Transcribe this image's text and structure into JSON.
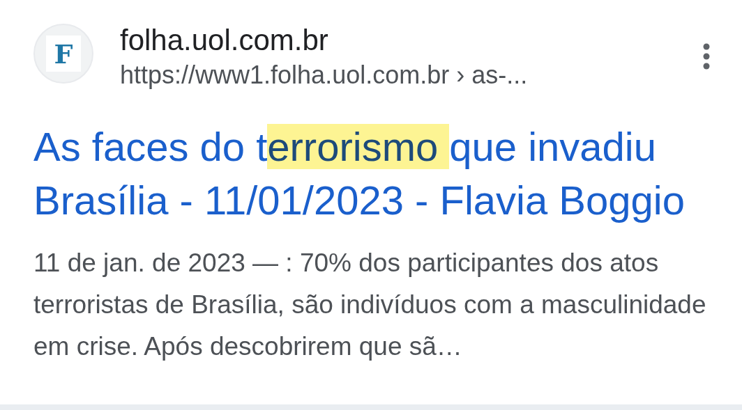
{
  "result": {
    "favicon": "F",
    "site_name": "folha.uol.com.br",
    "url": "https://www1.folha.uol.com.br › as-...",
    "title_parts": [
      {
        "text": "As faces do t",
        "highlighted": false
      },
      {
        "text": "errorismo ",
        "highlighted": true
      },
      {
        "text": "que invadiu Brasília - 11/01/2023 - Flavia Boggio",
        "highlighted": false
      }
    ],
    "snippet": "11 de jan. de 2023 — : 70% dos participantes dos atos terroristas de Brasília, são indivíduos com a masculinidade em crise. Após descobrirem que sã…"
  }
}
